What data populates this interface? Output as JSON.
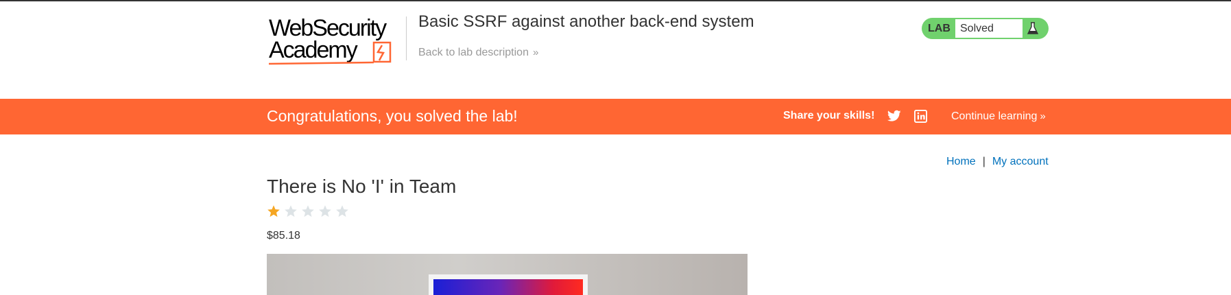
{
  "header": {
    "logo": {
      "line1": "WebSecurity",
      "line2": "Academy",
      "brand_color": "#ff6633"
    },
    "lab_title": "Basic SSRF against another back-end system",
    "back_link_label": "Back to lab description",
    "back_link_icon": "double-chevron-right-icon",
    "lab_status": {
      "badge": "LAB",
      "state": "Solved",
      "icon": "flask-icon",
      "color": "#70d16d"
    }
  },
  "banner": {
    "message": "Congratulations, you solved the lab!",
    "share_label": "Share your skills!",
    "share_icons": [
      "twitter-icon",
      "linkedin-icon"
    ],
    "continue_label": "Continue learning",
    "background": "#ff6633"
  },
  "nav": {
    "home_label": "Home",
    "separator": "|",
    "account_label": "My account",
    "link_color": "#0071bc"
  },
  "product": {
    "title": "There is No 'I' in Team",
    "rating": 1,
    "rating_max": 5,
    "price": "$85.18"
  }
}
